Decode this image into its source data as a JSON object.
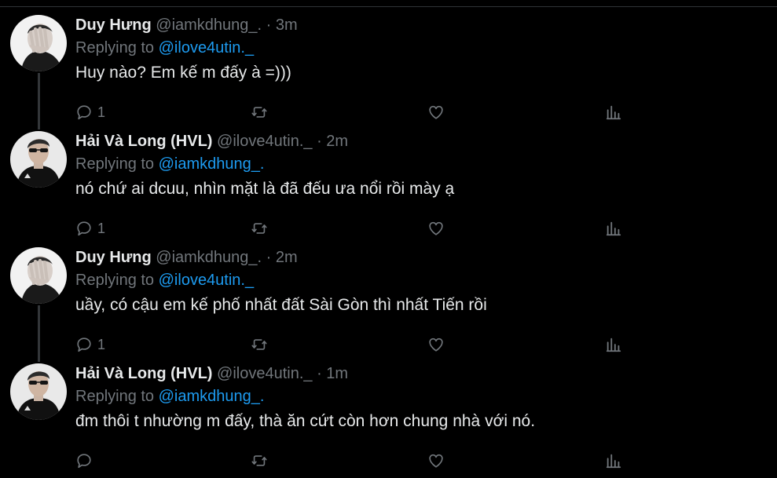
{
  "colors": {
    "background": "#000000",
    "text": "#e7e9ea",
    "muted": "#71767b",
    "link": "#1d9bf0"
  },
  "tweets": [
    {
      "name": "Duy Hưng",
      "handle": "@iamkdhung_.",
      "dot": "·",
      "time": "3m",
      "replying_prefix": "Replying to ",
      "replying_to": "@ilove4utin._",
      "text": "Huy nào? Em kế m đấy à =)))",
      "reply_count": "1",
      "avatar_icon": "avatar-hand-over-face"
    },
    {
      "name": "Hải Và Long (HVL)",
      "handle": "@ilove4utin._",
      "dot": "·",
      "time": "2m",
      "replying_prefix": "Replying to ",
      "replying_to": "@iamkdhung_.",
      "text": "nó chứ ai dcuu, nhìn mặt là đã đếu ưa nổi rồi mày ạ",
      "reply_count": "1",
      "avatar_icon": "avatar-man-sunglasses"
    },
    {
      "name": "Duy Hưng",
      "handle": "@iamkdhung_.",
      "dot": "·",
      "time": "2m",
      "replying_prefix": "Replying to ",
      "replying_to": "@ilove4utin._",
      "text": "uầy, có cậu em kế phố nhất đất Sài Gòn thì nhất Tiến rồi",
      "reply_count": "1",
      "avatar_icon": "avatar-hand-over-face"
    },
    {
      "name": "Hải Và Long (HVL)",
      "handle": "@ilove4utin._",
      "dot": "·",
      "time": "1m",
      "replying_prefix": "Replying to ",
      "replying_to": "@iamkdhung_.",
      "text": "đm thôi t nhường m đấy, thà ăn cứt còn hơn chung nhà với nó.",
      "reply_count": "",
      "avatar_icon": "avatar-man-sunglasses"
    }
  ]
}
